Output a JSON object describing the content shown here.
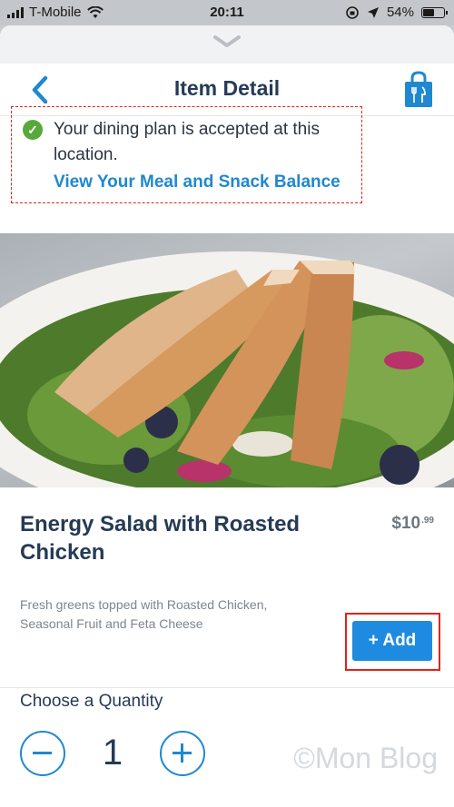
{
  "status_bar": {
    "carrier": "T-Mobile",
    "time": "20:11",
    "battery": "54%",
    "battery_level": 0.54,
    "signal_icon": "signal-bars-icon",
    "wifi_icon": "wifi-icon",
    "location_icon": "location-arrow-icon",
    "rotation_lock_icon": "rotation-lock-icon"
  },
  "header": {
    "title": "Item Detail",
    "back_icon": "chevron-left-icon",
    "bag_icon": "shopping-bag-icon",
    "handle_icon": "chevron-down-icon"
  },
  "dining_plan": {
    "message": "Your dining plan is accepted at this location.",
    "link": "View Your Meal and Snack Balance",
    "icon": "check-circle-icon"
  },
  "item": {
    "title": "Energy Salad with Roasted Chicken",
    "price_main": "$10",
    "price_cents": ".99",
    "description": "Fresh greens topped with Roasted Chicken, Seasonal Fruit and Feta Cheese",
    "add_label": "+ Add"
  },
  "quantity": {
    "label": "Choose a Quantity",
    "value": "1"
  },
  "watermark": "©Mon Blog",
  "colors": {
    "accent": "#1f88d0",
    "add_button": "#1f8be0",
    "title": "#253b56",
    "check": "#58a83b",
    "highlight_border": "#e0241b"
  }
}
